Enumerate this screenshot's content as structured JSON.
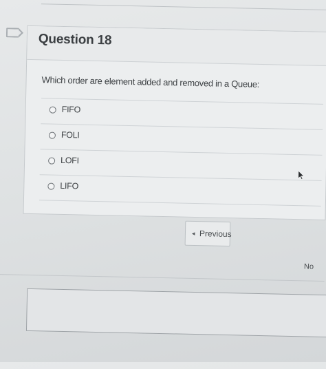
{
  "question": {
    "title": "Question 18",
    "text": "Which order are element added and removed in a Queue:",
    "options": [
      {
        "label": "FIFO",
        "selected": false
      },
      {
        "label": "FOLI",
        "selected": false
      },
      {
        "label": "LOFI",
        "selected": false
      },
      {
        "label": "LIFO",
        "selected": false
      }
    ]
  },
  "navigation": {
    "previous_label": "Previous",
    "previous_icon": "chevron-left-icon",
    "next_partial_label": "No"
  },
  "icons": {
    "flag": "flag-icon",
    "cursor": "mouse-pointer-icon"
  }
}
